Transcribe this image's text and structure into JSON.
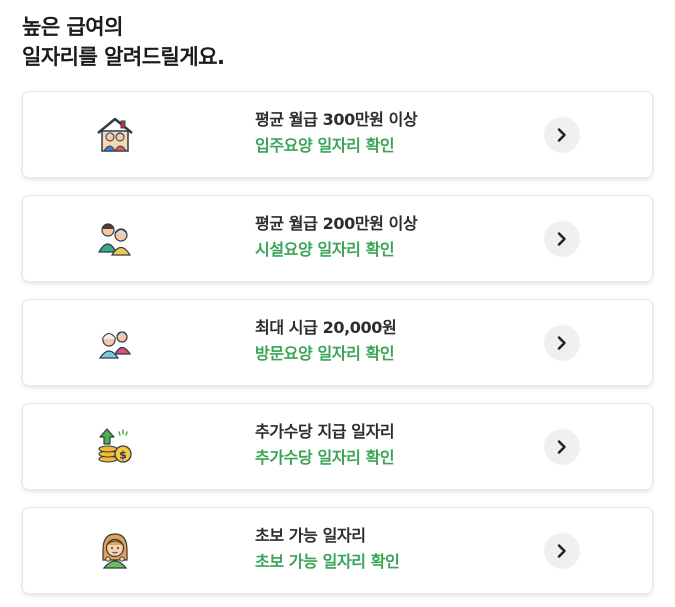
{
  "heading": {
    "line1": "높은 급여의",
    "line2": "일자리를 알려드릴게요."
  },
  "cards": [
    {
      "icon": "house-elderly-couple-icon",
      "title": "평균 월급 300만원 이상",
      "subtitle": "입주요양 일자리 확인"
    },
    {
      "icon": "caregiver-elderly-icon",
      "title": "평균 월급 200만원 이상",
      "subtitle": "시설요양 일자리 확인"
    },
    {
      "icon": "elderly-couple-icon",
      "title": "최대 시급 20,000원",
      "subtitle": "방문요양 일자리 확인"
    },
    {
      "icon": "coins-growth-icon",
      "title": "추가수당 지급 일자리",
      "subtitle": "추가수당 일자리 확인"
    },
    {
      "icon": "beginner-woman-icon",
      "title": "초보 가능 일자리",
      "subtitle": "초보 가능 일자리 확인"
    }
  ],
  "colors": {
    "accent_green": "#3aa457",
    "title_text": "#2d2d2d",
    "arrow_bg": "#eeeff1"
  }
}
